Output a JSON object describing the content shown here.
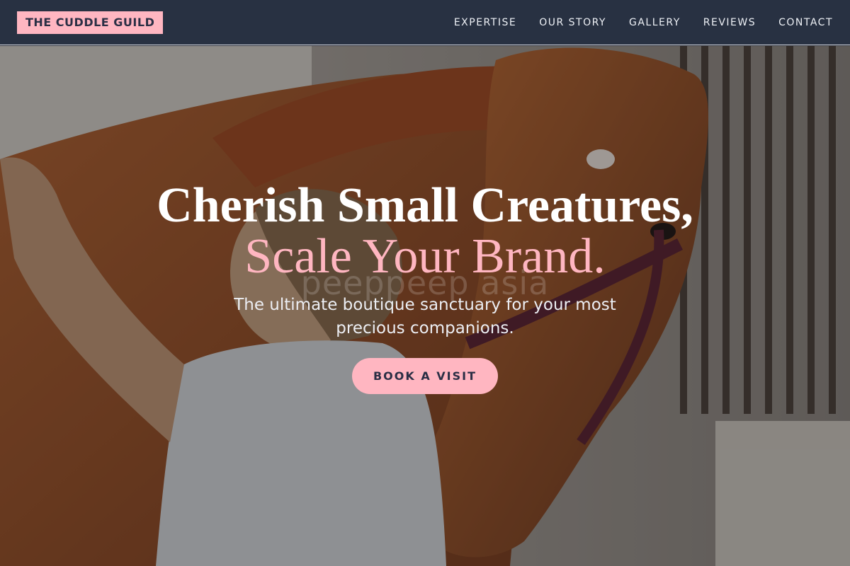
{
  "nav": {
    "brand": "THE CUDDLE GUILD",
    "links": [
      "EXPERTISE",
      "OUR STORY",
      "GALLERY",
      "REVIEWS",
      "CONTACT"
    ]
  },
  "hero": {
    "headline_line1": "Cherish Small Creatures,",
    "headline_line2": "Scale Your Brand.",
    "watermark": "peeppeep asia",
    "subtitle": "The ultimate boutique sanctuary for your most precious companions.",
    "cta_label": "BOOK A VISIT",
    "background": "photo of woman hugging a chestnut horse in a stable"
  },
  "colors": {
    "accent_pink": "#ffb6c1",
    "nav_bg": "#283142",
    "text_dark": "#2b2f45"
  }
}
